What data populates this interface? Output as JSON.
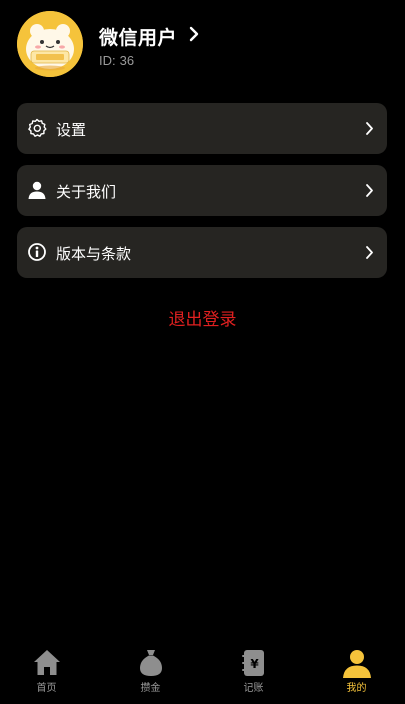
{
  "profile": {
    "name": "微信用户",
    "id_label": "ID:",
    "id_value": "36"
  },
  "menu": [
    {
      "label": "设置",
      "icon": "gear-icon"
    },
    {
      "label": "关于我们",
      "icon": "person-icon"
    },
    {
      "label": "版本与条款",
      "icon": "info-circle-icon"
    }
  ],
  "logout_label": "退出登录",
  "tabs": [
    {
      "label": "首页",
      "icon": "home-icon",
      "active": false
    },
    {
      "label": "攒金",
      "icon": "money-bag-icon",
      "active": false
    },
    {
      "label": "记账",
      "icon": "ledger-icon",
      "active": false
    },
    {
      "label": "我的",
      "icon": "user-icon",
      "active": true
    }
  ],
  "colors": {
    "background": "#000000",
    "card": "#262522",
    "accent": "#f5c33b",
    "danger": "#e02020",
    "muted": "#9a9a9a"
  }
}
